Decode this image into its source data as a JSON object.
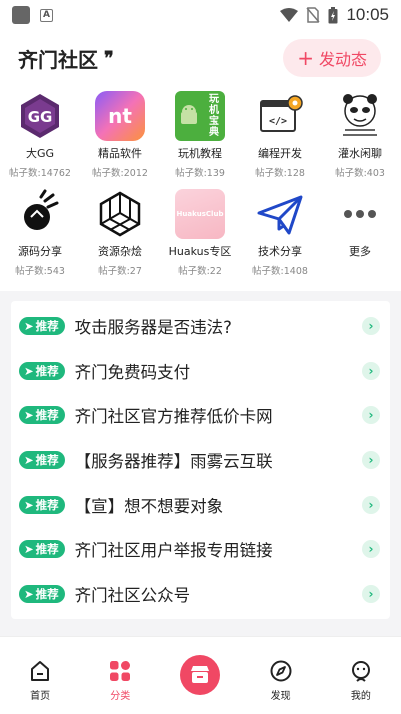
{
  "status_bar": {
    "time": "10:05"
  },
  "header": {
    "title": "齐门社区",
    "post_button": "发动态"
  },
  "categories": [
    {
      "name": "大GG",
      "count": "帖子数:14762"
    },
    {
      "name": "精品软件",
      "count": "帖子数:2012"
    },
    {
      "name": "玩机教程",
      "count": "帖子数:139"
    },
    {
      "name": "编程开发",
      "count": "帖子数:128"
    },
    {
      "name": "灌水闲聊",
      "count": "帖子数:403"
    },
    {
      "name": "源码分享",
      "count": "帖子数:543"
    },
    {
      "name": "资源杂烩",
      "count": "帖子数:27"
    },
    {
      "name": "Huakus专区",
      "count": "帖子数:22"
    },
    {
      "name": "技术分享",
      "count": "帖子数:1408"
    },
    {
      "name": "更多",
      "count": ""
    }
  ],
  "icon_texts": {
    "gg": "GG",
    "nt": "nt",
    "wanji": "玩机宝典",
    "huakus": "HuakusClub"
  },
  "recommend_badge": "推荐",
  "recommendations": [
    {
      "title": "攻击服务器是否违法?"
    },
    {
      "title": "齐门免费码支付"
    },
    {
      "title": "齐门社区官方推荐低价卡网"
    },
    {
      "title": "【服务器推荐】雨雾云互联"
    },
    {
      "title": "【宣】想不想要对象"
    },
    {
      "title": "齐门社区用户举报专用链接"
    },
    {
      "title": "齐门社区公众号"
    }
  ],
  "bottom_nav": [
    {
      "label": "首页",
      "icon": "home-icon"
    },
    {
      "label": "分类",
      "icon": "category-icon",
      "active": true
    },
    {
      "label": "",
      "icon": "store-icon"
    },
    {
      "label": "发现",
      "icon": "compass-icon"
    },
    {
      "label": "我的",
      "icon": "profile-icon"
    }
  ],
  "colors": {
    "accent": "#f04864",
    "badge_green": "#1fb87d",
    "section_bg": "#f4f4f6"
  }
}
